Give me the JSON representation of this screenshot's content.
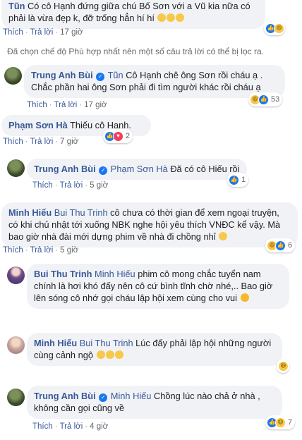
{
  "c0": {
    "name": "Tũn",
    "text": "Có cô Hạnh đứng giữa chú Bố Sơn với a Vũ kia nữa có phải là vừa đẹp k, đỡ trống hẳn hí hí",
    "like": "Thích",
    "reply": "Trả lời",
    "time": "17 giờ",
    "react_count": ""
  },
  "filter_note": "Đã chọn chế độ Phù hợp nhất nên một số câu trả lời có thể bị lọc ra.",
  "c1": {
    "name": "Trung Anh Bùi",
    "tag": "Tũn",
    "text": "Cô Hạnh chê ông Sơn rồi cháu ạ . Chắc phần hai ông Sơn phải đi tìm người khác rồi cháu ạ",
    "like": "Thích",
    "reply": "Trả lời",
    "time": "17 giờ",
    "react_count": "53"
  },
  "c2": {
    "name": "Phạm Sơn Hà",
    "text": "Thiếu cô Hạnh.",
    "like": "Thích",
    "reply": "Trả lời",
    "time": "7 giờ",
    "react_count": "2"
  },
  "c3": {
    "name": "Trung Anh Bùi",
    "tag": "Phạm Sơn Hà",
    "text": "Đã có cô Hiếu rồi",
    "like": "Thích",
    "reply": "Trả lời",
    "time": "5 giờ",
    "react_count": "1"
  },
  "c4": {
    "name": "Minh Hiếu",
    "tag": "Bui Thu Trinh",
    "text": "cô chưa có thời gian để xem ngoại truyện, có khi chủ nhật tới xuống NBK nghe hội yêu thích VNĐC kể vậy. Mà bao giờ nhà đài mới dựng phim về nhà đi chồng nhỉ",
    "like": "Thích",
    "reply": "Trả lời",
    "time": "5 giờ",
    "react_count": "6"
  },
  "c5": {
    "name": "Bui Thu Trinh",
    "tag": "Minh Hiếu",
    "text": "phim cô mong chắc tuyển nam chính là hơi khó đấy nên cô cứ bình tĩnh chờ nhé,.. Bao giờ lên sóng cô nhớ gọi cháu lập hội xem cùng cho vui",
    "react_count": ""
  },
  "c6": {
    "name": "Minh Hiếu",
    "tag": "Bui Thu Trinh",
    "text": "Lúc đấy phải lập hội những người cùng cảnh ngộ",
    "react_count": ""
  },
  "c7": {
    "name": "Trung Anh Bùi",
    "tag": "Minh Hiếu",
    "text": "Chồng lúc nào chả ở nhà , không cần gọi cũng về",
    "like": "Thích",
    "reply": "Trả lời",
    "time": "4 giờ",
    "react_count": "7"
  },
  "colors": {
    "link": "#385898",
    "bubble": "#f0f2f5",
    "meta": "#65676b",
    "like": "#1877f2"
  }
}
